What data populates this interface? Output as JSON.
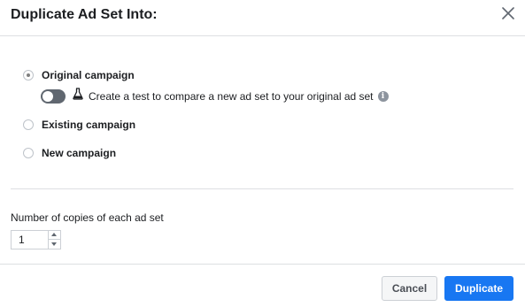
{
  "dialog": {
    "title": "Duplicate Ad Set Into:"
  },
  "options": [
    {
      "label": "Original campaign",
      "checked": true
    },
    {
      "label": "Existing campaign",
      "checked": false
    },
    {
      "label": "New campaign",
      "checked": false
    }
  ],
  "test_toggle": {
    "label": "Create a test to compare a new ad set to your original ad set",
    "enabled": false,
    "icon": "flask-icon",
    "info_icon": "info-icon"
  },
  "copies": {
    "label": "Number of copies of each ad set",
    "value": "1"
  },
  "footer": {
    "cancel_label": "Cancel",
    "duplicate_label": "Duplicate"
  },
  "colors": {
    "primary": "#1877f2",
    "toggle_off": "#606770",
    "divider": "#dddfe2"
  }
}
